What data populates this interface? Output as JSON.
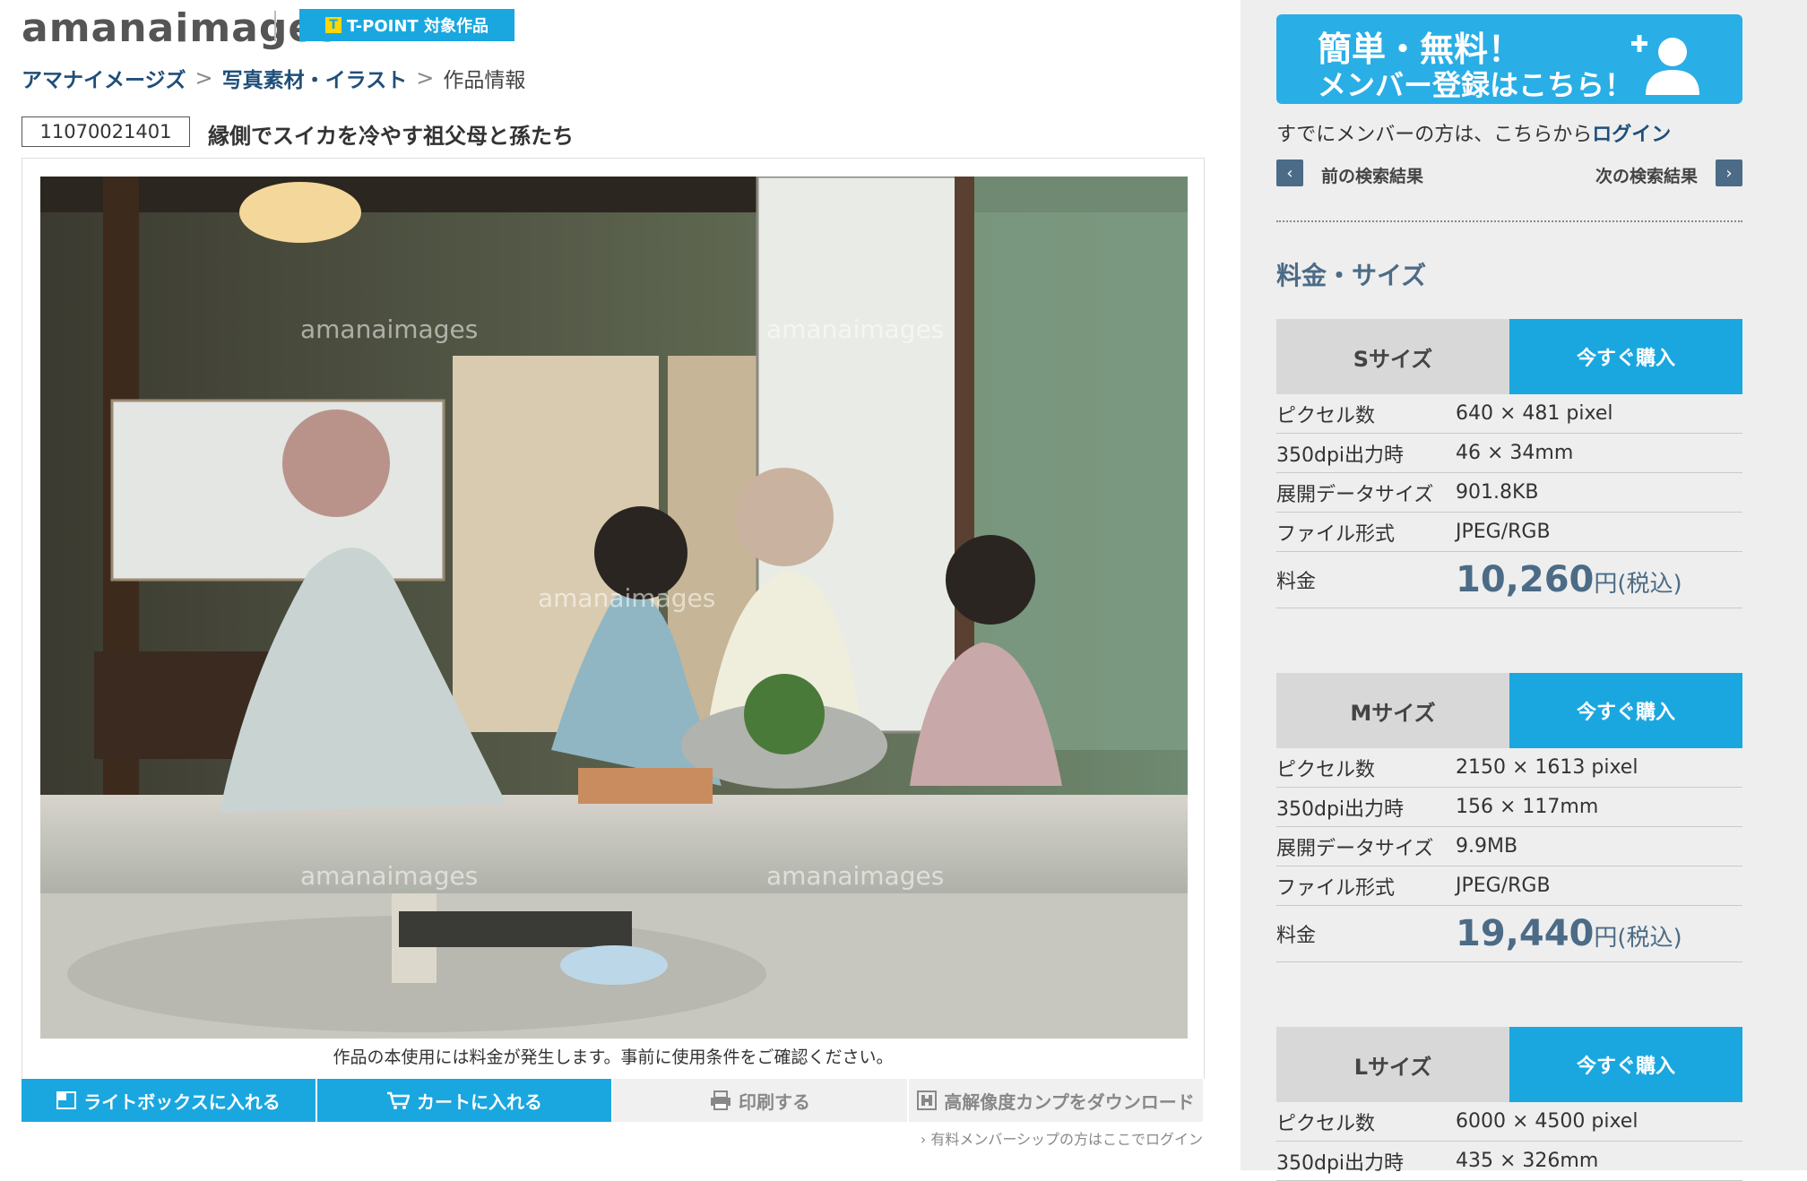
{
  "header": {
    "logo": "amanaimages",
    "tpoint": "T-POINT 対象作品",
    "tpoint_icon": "T"
  },
  "breadcrumb": {
    "items": [
      "アマナイメージズ",
      "写真素材・イラスト"
    ],
    "separator": ">",
    "current": "作品情報"
  },
  "product": {
    "id": "11070021401",
    "title": "縁側でスイカを冷やす祖父母と孫たち",
    "watermark": "amanaimages",
    "notice": "作品の本使用には料金が発生します。事前に使用条件をご確認ください。"
  },
  "actions": [
    {
      "label": "ライトボックスに入れる",
      "icon": "lightbox-icon"
    },
    {
      "label": "カートに入れる",
      "icon": "cart-icon"
    },
    {
      "label": "印刷する",
      "icon": "print-icon"
    },
    {
      "label": "高解像度カンプをダウンロード",
      "icon": "download-icon"
    }
  ],
  "member_login_link": "有料メンバーシップの方はここでログイン",
  "sidebar": {
    "register_line1": "簡単・無料！",
    "register_line2": "メンバー登録はこちら！",
    "login_prefix": "すでにメンバーの方は、こちらから",
    "login_link": "ログイン",
    "prev": "前の検索結果",
    "next": "次の検索結果",
    "section_title": "料金・サイズ"
  },
  "sizes": [
    {
      "name": "Sサイズ",
      "buy": "今すぐ購入",
      "rows": [
        {
          "k": "ピクセル数",
          "v": "640 × 481 pixel"
        },
        {
          "k": "350dpi出力時",
          "v": "46 × 34mm"
        },
        {
          "k": "展開データサイズ",
          "v": "901.8KB"
        },
        {
          "k": "ファイル形式",
          "v": "JPEG/RGB"
        }
      ],
      "price_label": "料金",
      "price": "10,260",
      "price_unit": "円(税込)"
    },
    {
      "name": "Mサイズ",
      "buy": "今すぐ購入",
      "rows": [
        {
          "k": "ピクセル数",
          "v": "2150 × 1613 pixel"
        },
        {
          "k": "350dpi出力時",
          "v": "156 × 117mm"
        },
        {
          "k": "展開データサイズ",
          "v": "9.9MB"
        },
        {
          "k": "ファイル形式",
          "v": "JPEG/RGB"
        }
      ],
      "price_label": "料金",
      "price": "19,440",
      "price_unit": "円(税込)"
    },
    {
      "name": "Lサイズ",
      "buy": "今すぐ購入",
      "rows": [
        {
          "k": "ピクセル数",
          "v": "6000 × 4500 pixel"
        },
        {
          "k": "350dpi出力時",
          "v": "435 × 326mm"
        }
      ]
    }
  ]
}
